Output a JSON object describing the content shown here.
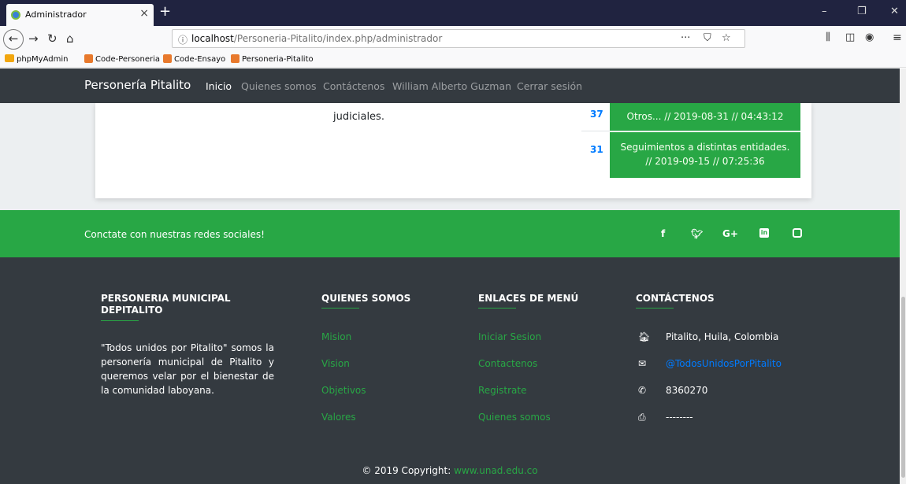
{
  "browser": {
    "tab_title": "Administrador",
    "tab_close": "×",
    "new_tab": "+",
    "win_min": "–",
    "win_max": "❐",
    "win_close": "✕",
    "url_host": "localhost",
    "url_path": "/Personeria-Pitalito/index.php/administrador",
    "url_more": "···",
    "bookmarks": [
      "phpMyAdmin",
      "Code-Personeria",
      "Code-Ensayo",
      "Personeria-Pitalito"
    ]
  },
  "site_nav": {
    "brand": "Personería Pitalito",
    "links": [
      "Inicio",
      "Quienes somos",
      "Contáctenos",
      "William Alberto Guzman",
      "Cerrar sesión"
    ]
  },
  "content": {
    "text": "judiciales.",
    "rows": [
      {
        "count": "37",
        "text1": "Otros... // 2019-08-31 // 04:43:12",
        "text2": ""
      },
      {
        "count": "31",
        "text1": "Seguimientos a distintas entidades.",
        "text2": "// 2019-09-15 // 07:25:36"
      }
    ]
  },
  "social": {
    "text": "Conctate con nuestras redes sociales!",
    "icons": [
      "facebook-icon",
      "twitter-icon",
      "google-plus-icon",
      "linkedin-icon",
      "instagram-icon"
    ]
  },
  "footer": {
    "col1": {
      "heading1": "PERSONERIA MUNICIPAL",
      "heading2": "DEPITALITO",
      "about": "\"Todos unidos por Pitalito\" somos la personería municipal de Pitalito y queremos velar por el bienestar de la comunidad laboyana."
    },
    "col2": {
      "heading": "QUIENES SOMOS",
      "links": [
        "Mision",
        "Vision",
        "Objetivos",
        "Valores"
      ]
    },
    "col3": {
      "heading": "ENLACES DE MENÚ",
      "links": [
        "Iniciar Sesion",
        "Contactenos",
        "Registrate",
        "Quienes somos"
      ]
    },
    "col4": {
      "heading": "CONTÁCTENOS",
      "address": "Pitalito, Huila, Colombia",
      "email": "@TodosUnidosPorPitalito",
      "phone": "8360270",
      "fax": "--------"
    },
    "copyright": "© 2019 Copyright:",
    "copyright_link": "www.unad.edu.co"
  }
}
